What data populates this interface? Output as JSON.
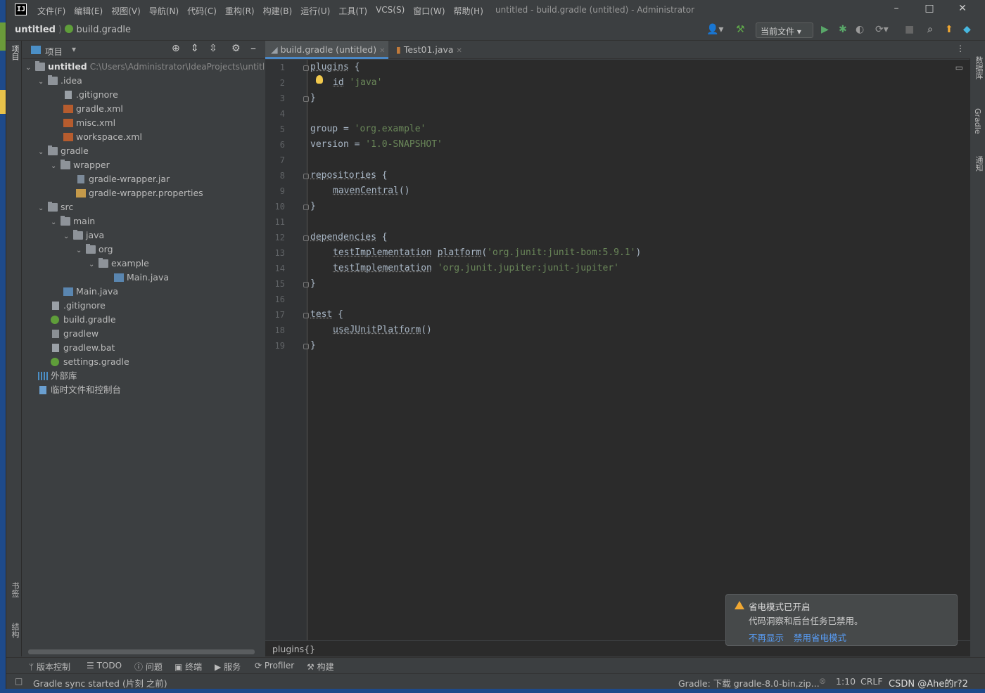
{
  "window": {
    "menu": [
      "文件(F)",
      "编辑(E)",
      "视图(V)",
      "导航(N)",
      "代码(C)",
      "重构(R)",
      "构建(B)",
      "运行(U)",
      "工具(T)",
      "VCS(S)",
      "窗口(W)",
      "帮助(H)"
    ],
    "title": "untitled - build.gradle (untitled) - Administrator"
  },
  "navbar": {
    "project": "untitled",
    "file": "build.gradle",
    "run_config": "当前文件"
  },
  "left_stripe": {
    "project": "项目",
    "bookmarks": "书签",
    "structure": "结构"
  },
  "right_stripe": {
    "database": "数据库",
    "gradle": "Gradle",
    "notifications": "通知"
  },
  "project_panel": {
    "title": "项目",
    "root_name": "untitled",
    "root_path": "C:\\Users\\Administrator\\IdeaProjects\\untitled",
    "items": [
      {
        "label": ".idea"
      },
      {
        "label": ".gitignore"
      },
      {
        "label": "gradle.xml"
      },
      {
        "label": "misc.xml"
      },
      {
        "label": "workspace.xml"
      },
      {
        "label": "gradle"
      },
      {
        "label": "wrapper"
      },
      {
        "label": "gradle-wrapper.jar"
      },
      {
        "label": "gradle-wrapper.properties"
      },
      {
        "label": "src"
      },
      {
        "label": "main"
      },
      {
        "label": "java"
      },
      {
        "label": "org"
      },
      {
        "label": "example"
      },
      {
        "label": "Main.java"
      },
      {
        "label": "Main.java"
      },
      {
        "label": ".gitignore"
      },
      {
        "label": "build.gradle"
      },
      {
        "label": "gradlew"
      },
      {
        "label": "gradlew.bat"
      },
      {
        "label": "settings.gradle"
      },
      {
        "label": "外部库"
      },
      {
        "label": "临时文件和控制台"
      }
    ]
  },
  "tabs": [
    {
      "label": "build.gradle (untitled)"
    },
    {
      "label": "Test01.java"
    }
  ],
  "editor": {
    "line_numbers": [
      "1",
      "2",
      "3",
      "4",
      "5",
      "6",
      "7",
      "8",
      "9",
      "10",
      "11",
      "12",
      "13",
      "14",
      "15",
      "16",
      "17",
      "18",
      "19"
    ],
    "code": {
      "l1_kw": "plugins",
      "l1_rest": " {",
      "l2_kw": "id",
      "l2_str": "'java'",
      "l3": "}",
      "l5_a": "group = ",
      "l5_str": "'org.example'",
      "l6_a": "version = ",
      "l6_str": "'1.0-SNAPSHOT'",
      "l8_kw": "repositories",
      "l8_rest": " {",
      "l9_kw": "mavenCentral",
      "l9_rest": "()",
      "l10": "}",
      "l12_kw": "dependencies",
      "l12_rest": " {",
      "l13_kw": "testImplementation",
      "l13_kw2": "platform",
      "l13_p1": "(",
      "l13_str": "'org.junit:junit-bom:5.9.1'",
      "l13_p2": ")",
      "l14_kw": "testImplementation",
      "l14_str": "'org.junit.jupiter:junit-jupiter'",
      "l15": "}",
      "l17_kw": "test",
      "l17_rest": " {",
      "l18_kw": "useJUnitPlatform",
      "l18_rest": "()",
      "l19": "}"
    },
    "breadcrumb": "plugins{}"
  },
  "notification": {
    "title": "省电模式已开启",
    "body": "代码洞察和后台任务已禁用。",
    "link1": "不再显示",
    "link2": "禁用省电模式"
  },
  "tool_strip": [
    "版本控制",
    "TODO",
    "问题",
    "终端",
    "服务",
    "Profiler",
    "构建"
  ],
  "status": {
    "left": "Gradle sync started (片刻 之前)",
    "gradle": "Gradle: 下载 gradle-8.0-bin.zip...",
    "position": "1:10",
    "line_ending": "CRLF",
    "watermark": "CSDN @Ahe的r?2"
  },
  "colors": {
    "accent": "#4a88c7",
    "string": "#6a8759",
    "gradle_green": "#5f9e3a",
    "warning": "#f0a732"
  }
}
